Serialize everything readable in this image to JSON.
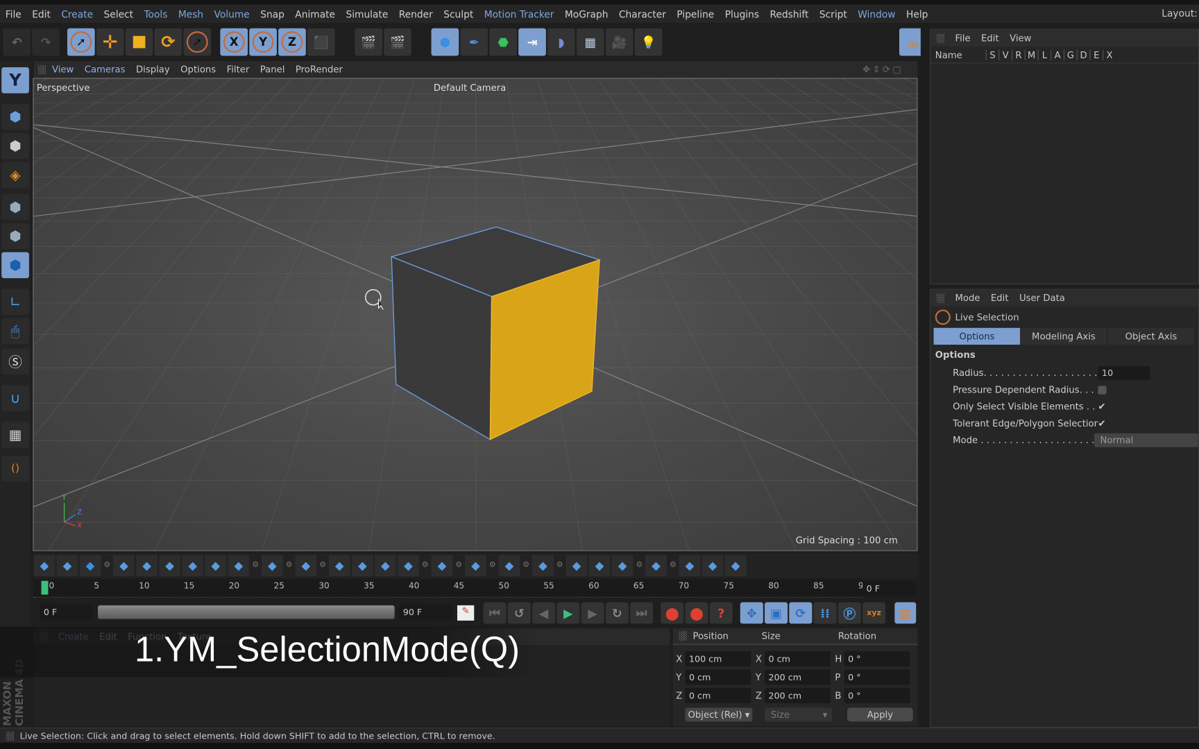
{
  "menu": [
    "File",
    "Edit",
    "Create",
    "Select",
    "Tools",
    "Mesh",
    "Volume",
    "Snap",
    "Animate",
    "Simulate",
    "Render",
    "Sculpt",
    "Motion Tracker",
    "MoGraph",
    "Character",
    "Pipeline",
    "Plugins",
    "Redshift",
    "Script",
    "Window",
    "Help"
  ],
  "menu_highlighted": [
    "Create",
    "Tools",
    "Mesh",
    "Volume",
    "Motion Tracker",
    "Window"
  ],
  "layout_label": "Layout:",
  "toolbar": {
    "x_label": "X",
    "y_label": "Y",
    "z_label": "Z"
  },
  "viewport": {
    "menu": [
      "View",
      "Cameras",
      "Display",
      "Options",
      "Filter",
      "Panel",
      "ProRender"
    ],
    "perspective_label": "Perspective",
    "camera_label": "Default Camera",
    "grid_spacing": "Grid Spacing : 100 cm",
    "axis": {
      "y": "Y",
      "z": "Z",
      "x": "X"
    }
  },
  "colors": {
    "accent": "#7d9fcf",
    "selected_polygon": "#d9a418",
    "edge": "#6d9ee0"
  },
  "object_manager": {
    "menu": [
      "File",
      "Edit",
      "View"
    ],
    "columns": [
      "Name",
      "S",
      "V",
      "R",
      "M",
      "L",
      "A",
      "G",
      "D",
      "E",
      "X"
    ]
  },
  "attributes": {
    "menu": [
      "Mode",
      "Edit",
      "User Data"
    ],
    "tool_name": "Live Selection",
    "tabs": [
      "Options",
      "Modeling Axis",
      "Object Axis"
    ],
    "active_tab": "Options",
    "section": "Options",
    "fields": [
      {
        "label": "Radius. . . . . . . . . . . . . . . . . . . . . . .",
        "value": "10",
        "type": "number"
      },
      {
        "label": "Pressure Dependent Radius. . . . .",
        "value": "",
        "type": "checkbox",
        "checked": false
      },
      {
        "label": "Only Select Visible Elements . . . .",
        "value": "✔",
        "type": "checkbox",
        "checked": true
      },
      {
        "label": "Tolerant Edge/Polygon Selection",
        "value": "✔",
        "type": "checkbox",
        "checked": true
      },
      {
        "label": "Mode . . . . . . . . . . . . . . . . . . . . . . . .",
        "value": "Normal",
        "type": "select"
      }
    ]
  },
  "timeline": {
    "ticks": [
      "0",
      "5",
      "10",
      "15",
      "20",
      "25",
      "30",
      "35",
      "40",
      "45",
      "50",
      "55",
      "60",
      "65",
      "70",
      "75",
      "80",
      "85",
      "90"
    ],
    "current_frame": "0 F",
    "start_field": "0 F",
    "range_start": "0 F",
    "range_end": "90 F",
    "end_field": "90 F"
  },
  "materials": {
    "menu": [
      "Create",
      "Edit",
      "Function",
      "Texture"
    ]
  },
  "coordinates": {
    "headers": [
      "Position",
      "Size",
      "Rotation"
    ],
    "rows": [
      {
        "pl": "X",
        "p": "100 cm",
        "sl": "X",
        "s": "0 cm",
        "rl": "H",
        "r": "0 °"
      },
      {
        "pl": "Y",
        "p": "0 cm",
        "sl": "Y",
        "s": "200 cm",
        "rl": "P",
        "r": "0 °"
      },
      {
        "pl": "Z",
        "p": "0 cm",
        "sl": "Z",
        "s": "200 cm",
        "rl": "B",
        "r": "0 °"
      }
    ],
    "mode_select": "Object (Rel)",
    "size_select": "Size",
    "apply": "Apply"
  },
  "subtitle": "1.YM_SelectionMode(Q)",
  "brand": "MAXON CINEMA 4D",
  "status": "Live Selection: Click and drag to select elements. Hold down SHIFT to add to the selection, CTRL to remove."
}
